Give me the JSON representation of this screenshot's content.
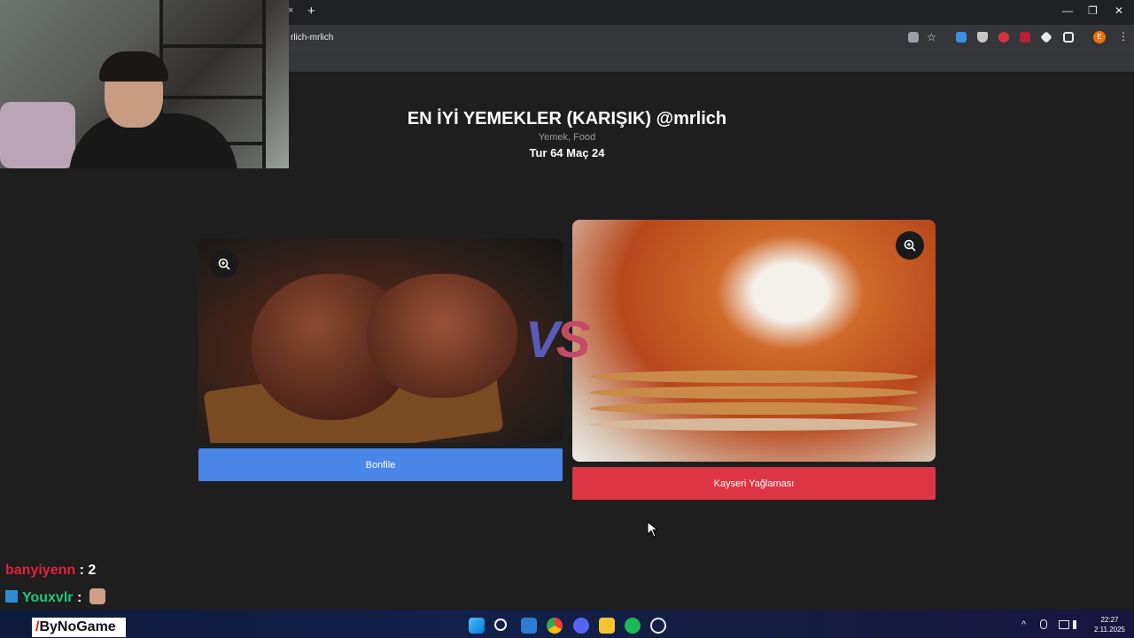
{
  "browser": {
    "url_fragment": "rlich-mrlich",
    "tab_close": "×",
    "new_tab": "+",
    "minimize": "—",
    "restore": "❐",
    "close": "✕",
    "profile_initial": "E"
  },
  "page": {
    "title": "EN İYİ YEMEKLER (KARIŞIK) @mrlich",
    "subtitle": "Yemek, Food",
    "round": "Tur 64 Maç 24",
    "vs_v": "V",
    "vs_s": "S"
  },
  "options": [
    {
      "label": "Bonfile",
      "color": "#4a86e8"
    },
    {
      "label": "Kayseri Yağlaması",
      "color": "#dd3545"
    }
  ],
  "chat": [
    {
      "user": "banyiyenn",
      "separator": " : ",
      "message": "2"
    },
    {
      "user": "Youxvlr",
      "separator": " : ",
      "message": ""
    }
  ],
  "taskbar": {
    "logo": "ByNoGame",
    "logo_mark": "/",
    "time": "22:27",
    "date": "2.11.2025",
    "tray_up": "^"
  },
  "colors": {
    "accent_blue": "#4a86e8",
    "accent_red": "#dd3545",
    "vs_blue": "#5a5ab8",
    "vs_pink": "#c44b64",
    "page_bg": "#1e1e1e"
  }
}
